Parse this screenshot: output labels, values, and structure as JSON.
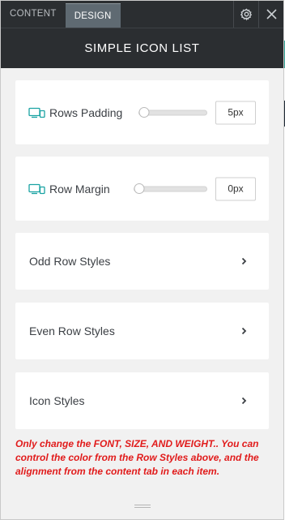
{
  "header": {
    "tabs": [
      {
        "label": "Content",
        "active": false
      },
      {
        "label": "Design",
        "active": true
      }
    ],
    "title": "SIMPLE ICON LIST",
    "icons": [
      "settings-gear-icon",
      "close-icon"
    ]
  },
  "rows_padding": {
    "label": "Rows Padding",
    "value": "5px",
    "level": 0.0
  },
  "row_margin": {
    "label": "Row Margin",
    "value": "0px",
    "level": 0.0
  },
  "sections": [
    {
      "label": "Odd Row Styles"
    },
    {
      "label": "Even Row Styles"
    },
    {
      "label": "Icon Styles"
    }
  ],
  "note": "Only change the FONT, SIZE, AND WEIGHT.. You can control the color from the Row Styles above, and the alignment from the content tab in each item.",
  "colors": {
    "header_bg": "#2b2e31",
    "active_tab": "#5f6a72",
    "panel_bg": "#f1f1f1",
    "device_icon": "#1aa3a3",
    "note_text": "#e11b1b"
  }
}
